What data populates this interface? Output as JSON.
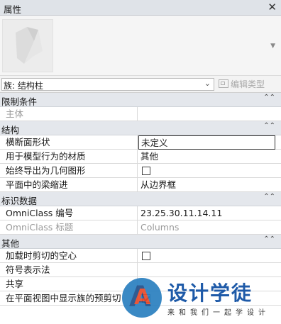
{
  "window": {
    "title": "属性"
  },
  "type_selector": {
    "value": "族: 结构柱",
    "edit_type_label": "编辑类型"
  },
  "sections": [
    {
      "label": "限制条件",
      "rows": [
        {
          "name": "主体",
          "value": "",
          "disabled": true
        }
      ]
    },
    {
      "label": "结构",
      "rows": [
        {
          "name": "横断面形状",
          "value": "未定义",
          "focused": true
        },
        {
          "name": "用于模型行为的材质",
          "value": "其他"
        },
        {
          "name": "始终导出为几何图形",
          "checkbox": false
        },
        {
          "name": "平面中的梁缩进",
          "value": "从边界框"
        }
      ]
    },
    {
      "label": "标识数据",
      "rows": [
        {
          "name": "OmniClass 编号",
          "value": "23.25.30.11.14.11"
        },
        {
          "name": "OmniClass 标题",
          "value": "Columns",
          "disabled": true
        }
      ]
    },
    {
      "label": "其他",
      "rows": [
        {
          "name": "加载时剪切的空心",
          "checkbox": false
        },
        {
          "name": "符号表示法",
          "value": ""
        },
        {
          "name": "共享",
          "value": ""
        },
        {
          "name": "在平面视图中显示族的预剪切",
          "checkbox": true
        }
      ]
    }
  ],
  "watermark": {
    "brand": "设计学徒",
    "slogan": "来和我们一起学设计"
  }
}
